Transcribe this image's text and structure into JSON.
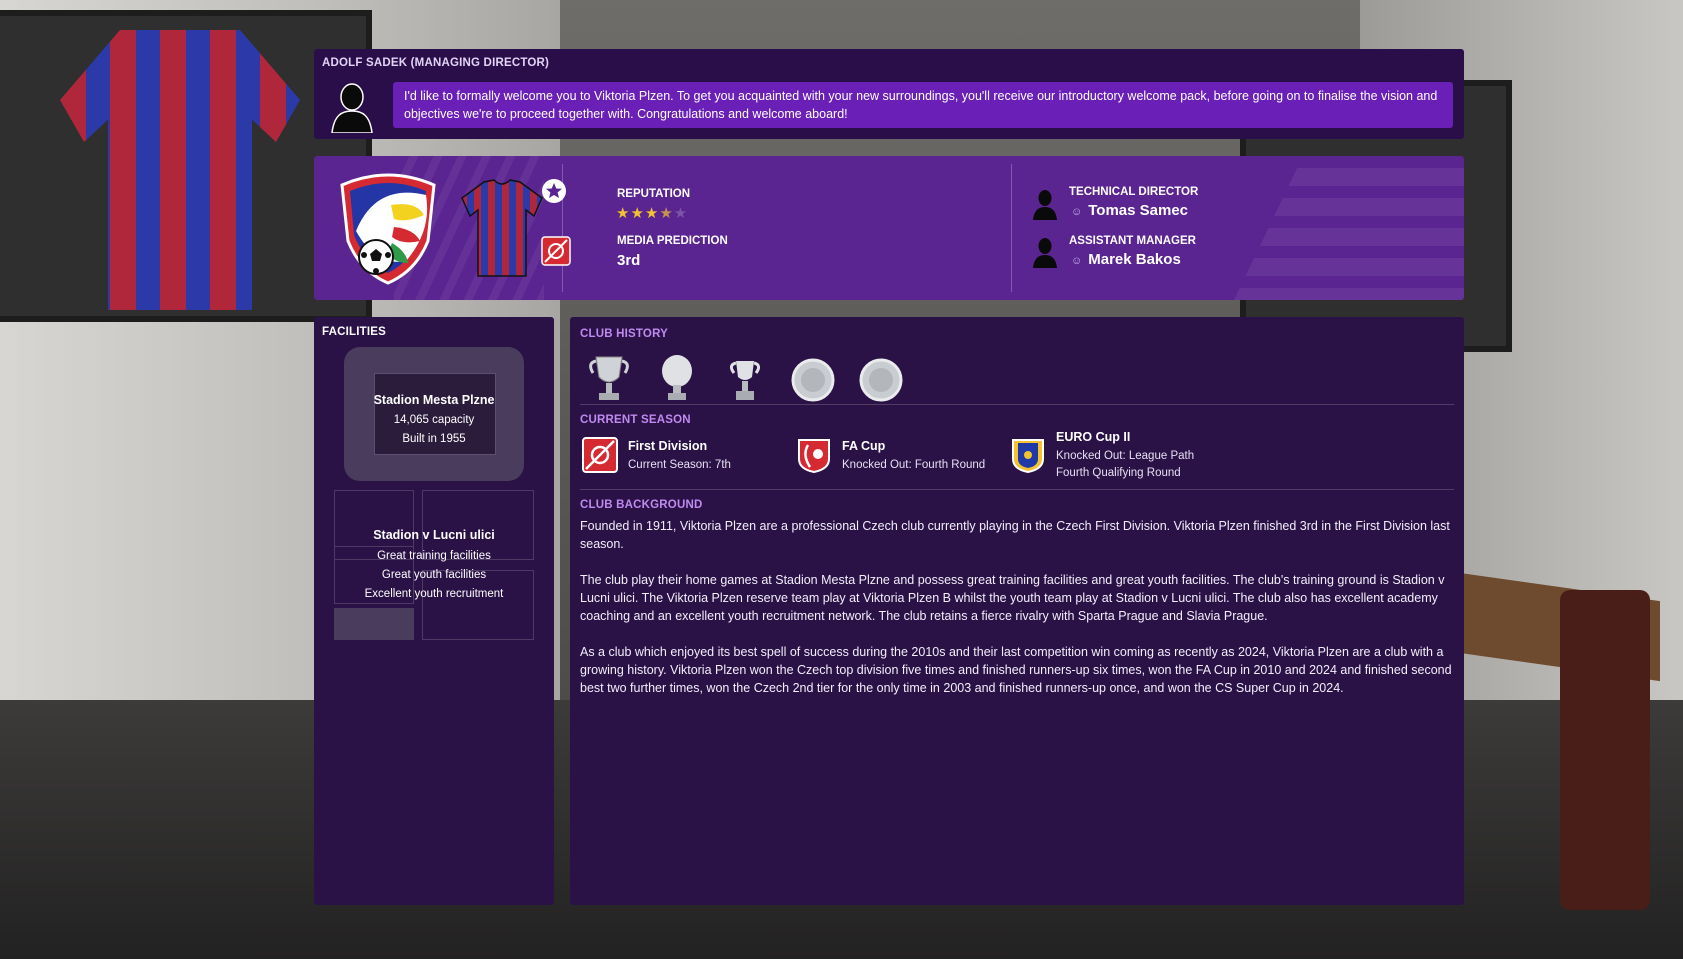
{
  "colors": {
    "accent": "#6a1fb6",
    "panel": "#2a1246",
    "overview": "#5a2591",
    "header_violet": "#c08af0"
  },
  "message": {
    "header": "ADOLF SADEK (MANAGING DIRECTOR)",
    "text": "I'd like to formally welcome you to Viktoria Plzen. To get you acquainted with your new surroundings, you'll receive our introductory welcome pack, before going on to finalise the vision and objectives we're to proceed together with. Congratulations and welcome aboard!"
  },
  "overview": {
    "reputation_label": "REPUTATION",
    "reputation_stars": 3.5,
    "reputation_max": 5,
    "media_label": "MEDIA PREDICTION",
    "media_value": "3rd",
    "staff": [
      {
        "role": "TECHNICAL DIRECTOR",
        "name": "Tomas Samec"
      },
      {
        "role": "ASSISTANT MANAGER",
        "name": "Marek Bakos"
      }
    ]
  },
  "facilities": {
    "header": "FACILITIES",
    "stadium": {
      "name": "Stadion Mesta Plzne",
      "capacity": "14,065 capacity",
      "built": "Built in 1955"
    },
    "training": {
      "name": "Stadion v Lucni ulici",
      "lines": [
        "Great training facilities",
        "Great youth facilities",
        "Excellent youth recruitment"
      ]
    }
  },
  "history": {
    "header": "CLUB HISTORY",
    "trophies": [
      "league-trophy-icon",
      "cup-trophy-icon",
      "small-cup-icon",
      "super-cup-plate-icon",
      "plate-trophy-icon"
    ]
  },
  "season": {
    "header": "CURRENT SEASON",
    "competitions": [
      {
        "name": "First Division",
        "lines": [
          "Current Season: 7th"
        ]
      },
      {
        "name": "FA Cup",
        "lines": [
          "Knocked Out: Fourth Round"
        ]
      },
      {
        "name": "EURO Cup II",
        "lines": [
          "Knocked Out: League Path",
          "Fourth Qualifying Round"
        ]
      }
    ]
  },
  "background": {
    "header": "CLUB BACKGROUND",
    "paragraphs": [
      "Founded in 1911, Viktoria Plzen are a professional Czech club currently playing in the Czech First Division. Viktoria Plzen finished 3rd in the First Division last season.",
      "The club play their home games at Stadion Mesta Plzne and possess great training facilities and great youth facilities. The club's training ground is Stadion v Lucni ulici. The Viktoria Plzen reserve team play at Viktoria Plzen B whilst the youth team play at Stadion v Lucni ulici. The club also has excellent academy coaching and an excellent youth recruitment network. The club retains a fierce rivalry with Sparta Prague and Slavia Prague.",
      "As a club which enjoyed its best spell of success during the 2010s and their last competition win coming as recently as 2024, Viktoria Plzen are a club with a growing history. Viktoria Plzen won the Czech top division five times and finished runners-up six times, won the FA Cup in 2010 and 2024 and finished second best two further times, won the Czech 2nd tier for the only time in 2003 and finished runners-up once, and won the CS Super Cup in 2024."
    ]
  }
}
